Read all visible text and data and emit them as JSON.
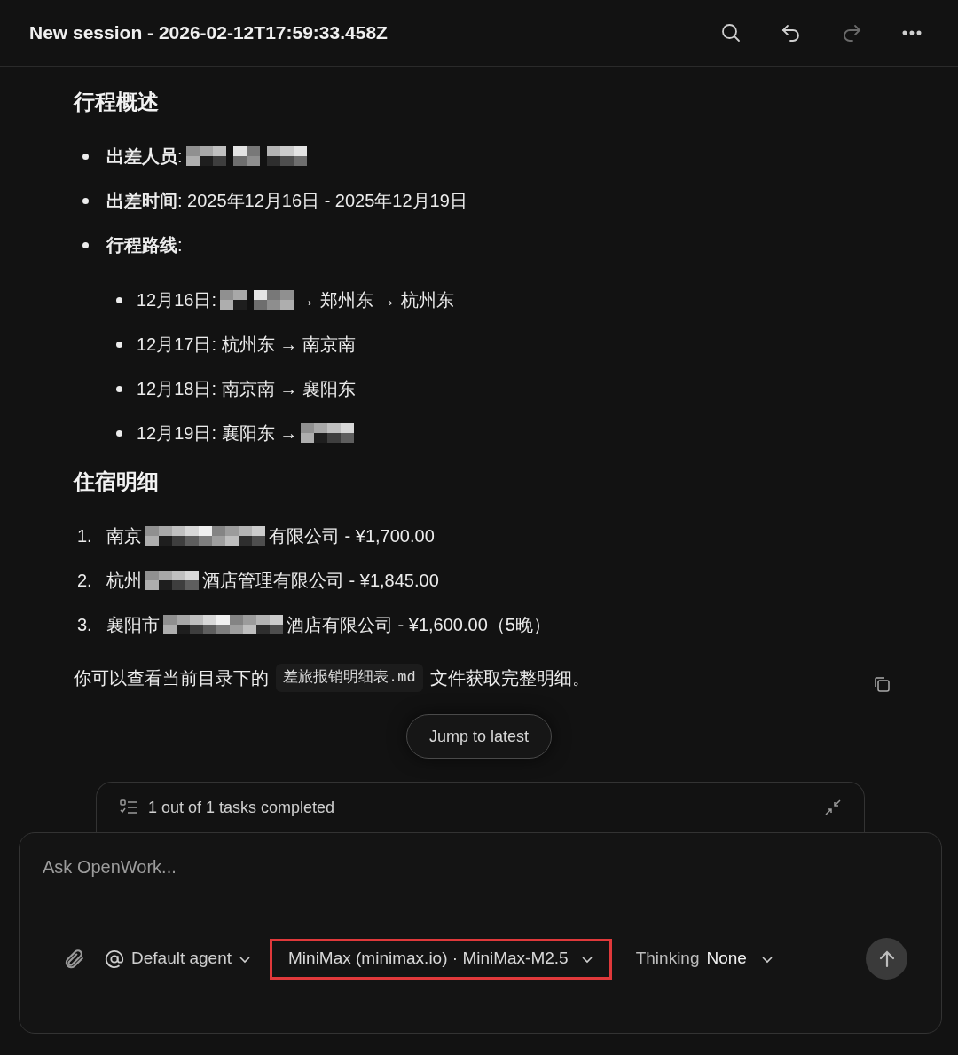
{
  "window": {
    "title": "New session - 2026-02-12T17:59:33.458Z"
  },
  "toolbar": [
    {
      "kind": "search",
      "disabled": false
    },
    {
      "kind": "undo",
      "disabled": false
    },
    {
      "kind": "redo",
      "disabled": true
    },
    {
      "kind": "more",
      "disabled": false
    }
  ],
  "message": {
    "sections": [
      {
        "heading": "行程概述",
        "kind": "bullets",
        "items": [
          {
            "parts": [
              {
                "kind": "text",
                "text": "**出差人员**:"
              },
              {
                "kind": "redacted-small"
              },
              {
                "kind": "redacted-tiny"
              },
              {
                "kind": "redacted-small"
              }
            ]
          },
          {
            "parts": [
              {
                "kind": "text",
                "text": "**出差时间**: 2025年12月16日 - 2025年12月19日"
              }
            ]
          },
          {
            "parts": [
              {
                "kind": "text",
                "text": "**行程路线**:"
              }
            ],
            "children": [
              {
                "parts": [
                  {
                    "kind": "text",
                    "text": "12月16日:"
                  },
                  {
                    "kind": "redacted-tiny"
                  },
                  {
                    "kind": "redacted-small"
                  },
                  {
                    "kind": "text",
                    "text": "→ 郑州东 → 杭州东"
                  }
                ]
              },
              {
                "parts": [
                  {
                    "kind": "text",
                    "text": "12月17日: 杭州东 → 南京南"
                  }
                ]
              },
              {
                "parts": [
                  {
                    "kind": "text",
                    "text": "12月18日: 南京南 → 襄阳东"
                  }
                ]
              },
              {
                "parts": [
                  {
                    "kind": "text",
                    "text": "12月19日: 襄阳东 →"
                  },
                  {
                    "kind": "redacted-medium"
                  }
                ]
              }
            ]
          }
        ]
      },
      {
        "heading": "住宿明细",
        "kind": "numbered",
        "items": [
          {
            "number": "1.",
            "parts": [
              {
                "kind": "text",
                "text": "南京"
              },
              {
                "kind": "redacted-large"
              },
              {
                "kind": "text",
                "text": "有限公司 - ¥1,700.00"
              }
            ]
          },
          {
            "number": "2.",
            "parts": [
              {
                "kind": "text",
                "text": "杭州"
              },
              {
                "kind": "redacted-medium"
              },
              {
                "kind": "text",
                "text": "酒店管理有限公司 - ¥1,845.00"
              }
            ]
          },
          {
            "number": "3.",
            "parts": [
              {
                "kind": "text",
                "text": "襄阳市"
              },
              {
                "kind": "redacted-large"
              },
              {
                "kind": "text",
                "text": "酒店有限公司 - ¥1,600.00（5晚）"
              }
            ]
          }
        ]
      }
    ],
    "paragraph": [
      {
        "kind": "text",
        "text": "你可以查看当前目录下的"
      },
      {
        "kind": "code",
        "text": "差旅报销明细表.md"
      },
      {
        "kind": "text",
        "text": "文件获取完整明细。"
      }
    ]
  },
  "jump_button": "Jump to latest",
  "tasks": {
    "summary": "1 out of 1 tasks completed"
  },
  "composer": {
    "placeholder": "Ask OpenWork...",
    "agent": "Default agent",
    "model": "MiniMax (minimax.io) · MiniMax-M2.5",
    "model_highlighted": true,
    "thinking_label": "Thinking",
    "thinking_value": "None"
  }
}
